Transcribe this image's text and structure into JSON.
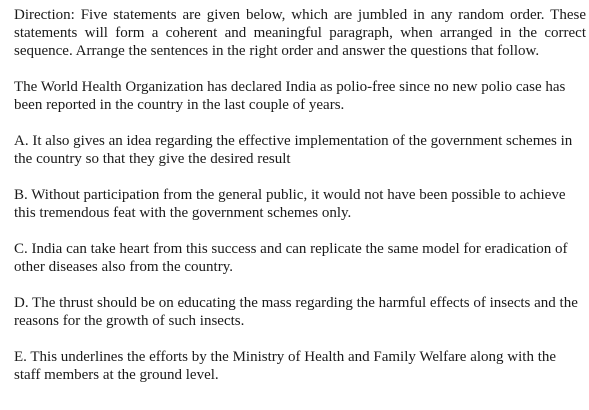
{
  "direction": "Direction: Five statements are given below, which are jumbled in any random order. These statements will form a coherent and meaningful paragraph, when arranged in the correct sequence. Arrange the sentences in the right order and answer the questions that follow.",
  "intro": "The World Health Organization has declared India as polio-free since no new polio case has been reported in the country in the last couple of years.",
  "statements": [
    "A. It also gives an idea regarding the effective implementation of the government schemes in the country so that they give the desired result",
    "B. Without participation from the general public, it would not have been possible to achieve this tremendous feat with the government schemes only.",
    "C. India can take heart from this success and can replicate the same model for eradication of other diseases also from the country.",
    "D. The thrust should be on educating the mass regarding the harmful effects of insects and the reasons for the growth of such insects.",
    "E. This underlines the efforts by the Ministry of Health and Family Welfare along with the staff members at the ground level."
  ]
}
